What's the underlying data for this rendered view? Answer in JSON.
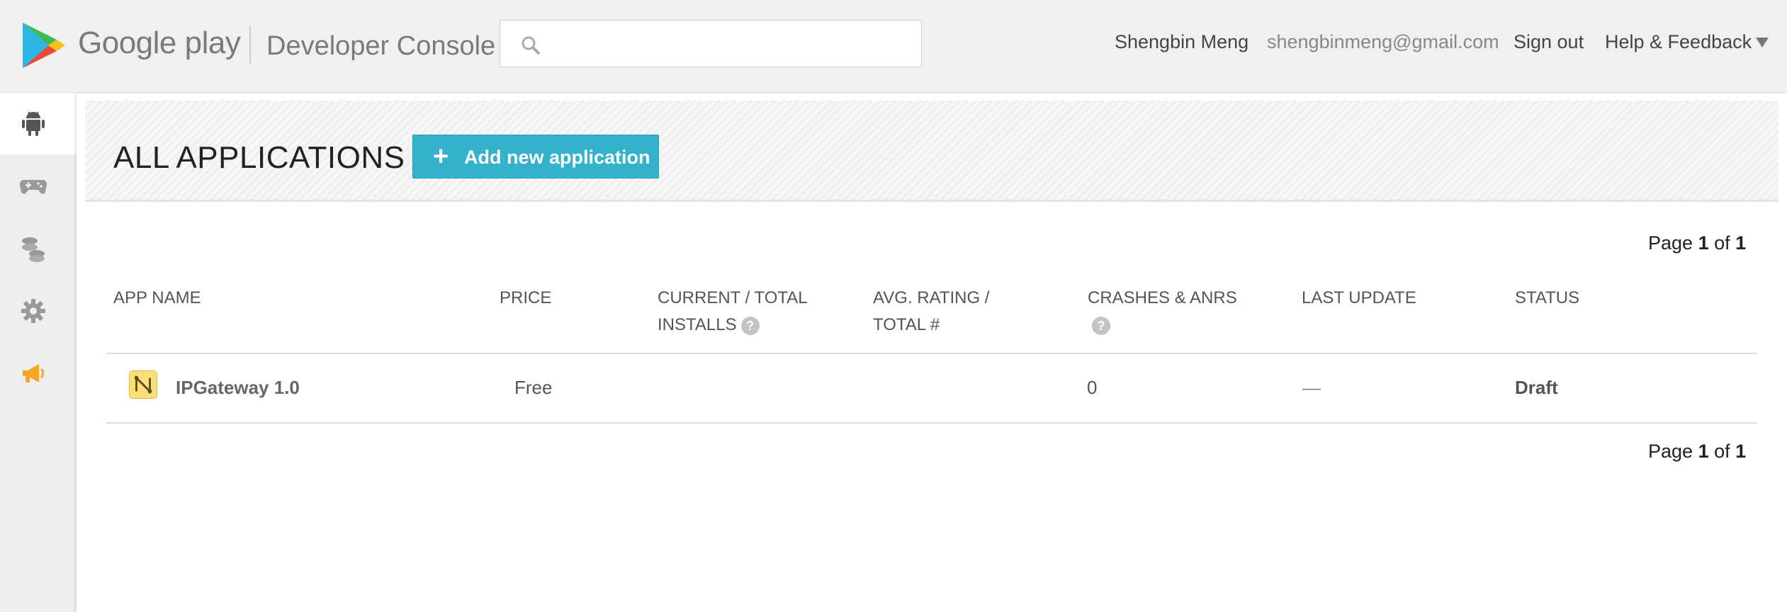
{
  "header": {
    "brand": "Google play",
    "subtitle": "Developer Console",
    "search": {
      "placeholder": "",
      "value": ""
    },
    "user_name": "Shengbin Meng",
    "user_email": "shengbinmeng@gmail.com",
    "sign_out": "Sign out",
    "help": "Help & Feedback"
  },
  "sidebar": {
    "items": [
      {
        "icon": "android-icon",
        "active": true
      },
      {
        "icon": "gamepad-icon",
        "active": false
      },
      {
        "icon": "coins-icon",
        "active": false
      },
      {
        "icon": "gear-icon",
        "active": false
      },
      {
        "icon": "megaphone-icon",
        "active": false
      }
    ]
  },
  "main": {
    "title": "ALL APPLICATIONS",
    "add_button": "Add new application",
    "pager": {
      "prefix": "Page",
      "current": "1",
      "sep": "of",
      "total": "1"
    },
    "columns": {
      "app_name": "APP NAME",
      "price": "PRICE",
      "installs_line1": "CURRENT / TOTAL",
      "installs_line2": "INSTALLS",
      "rating_line1": "AVG. RATING /",
      "rating_line2": "TOTAL #",
      "crashes": "CRASHES & ANRS",
      "last_update": "LAST UPDATE",
      "status": "STATUS"
    },
    "rows": [
      {
        "name": "IPGateway 1.0",
        "price": "Free",
        "installs": "",
        "rating": "",
        "crashes": "0",
        "last_update": "—",
        "status": "Draft"
      }
    ]
  },
  "colors": {
    "accent": "#33b2cb",
    "header_bg": "#f0f0f0",
    "sidebar_active": "#ffffff",
    "megaphone": "#f5a623"
  }
}
